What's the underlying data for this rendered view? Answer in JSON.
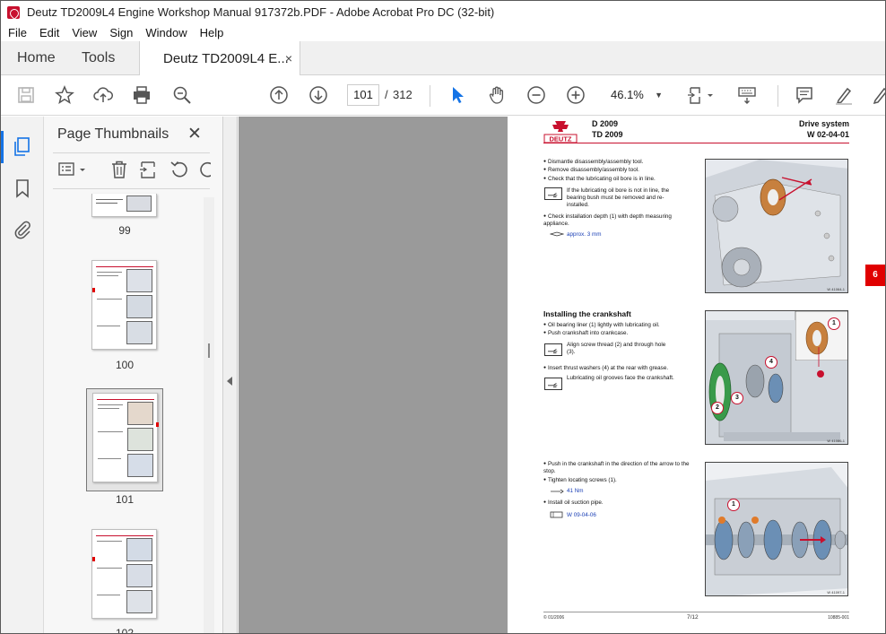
{
  "window": {
    "title": "Deutz TD2009L4 Engine Workshop Manual 917372b.PDF - Adobe Acrobat Pro DC (32-bit)"
  },
  "menu": [
    "File",
    "Edit",
    "View",
    "Sign",
    "Window",
    "Help"
  ],
  "tabs": {
    "home": "Home",
    "tools": "Tools",
    "document": "Deutz TD2009L4 E...",
    "close": "×"
  },
  "toolbar": {
    "page_current": "101",
    "page_separator": "/",
    "page_total": "312",
    "zoom": "46.1%"
  },
  "panel": {
    "title": "Page Thumbnails",
    "close": "✕",
    "thumbnails": [
      {
        "label": "99"
      },
      {
        "label": "100"
      },
      {
        "label": "101",
        "selected": true
      },
      {
        "label": "102"
      }
    ]
  },
  "page": {
    "header": {
      "left_line1": "D 2009",
      "left_line2": "TD 2009",
      "right_line1": "Drive system",
      "right_line2": "W 02-04-01"
    },
    "chapter_tab": "6",
    "section1": {
      "bullets": [
        "Dismantle disassembly/assembly tool.",
        "Remove disassembly/assembly tool.",
        "Check that the lubricating oil bore is in line."
      ],
      "note": "If the lubricating oil bore is not in line, the bearing bush must be removed and re-installed.",
      "bullet4": "Check installation depth (1) with depth measuring appliance.",
      "spec": "approx. 3 mm",
      "image_caption": "W 41064-1"
    },
    "section2": {
      "title": "Installing the crankshaft",
      "bullets": [
        "Oil bearing liner (1) lightly with lubricating oil.",
        "Push crankshaft into crankcase."
      ],
      "note1": "Align screw thread (2) and through hole (3).",
      "bullet3": "Insert thrust washers (4) at the rear with grease.",
      "note2": "Lubricating oil grooves face the crankshaft.",
      "image_caption": "W 41086-1",
      "callouts": [
        "1",
        "2",
        "3",
        "4"
      ]
    },
    "section3": {
      "bullets": [
        "Push in the crankshaft in the direction of the arrow to the stop.",
        "Tighten locating screws (1)."
      ],
      "spec": "41 Nm",
      "bullet3": "Install oil suction pipe.",
      "ref": "W 09-04-06",
      "image_caption": "W 41097-1",
      "callouts": [
        "1",
        "1"
      ]
    },
    "footer": {
      "left": "© 01/2006",
      "center": "7/12",
      "right": "10885-001"
    }
  },
  "colors": {
    "accent_blue": "#1473e6",
    "deutz_red": "#c8102e",
    "spec_blue": "#1a3fb5"
  }
}
